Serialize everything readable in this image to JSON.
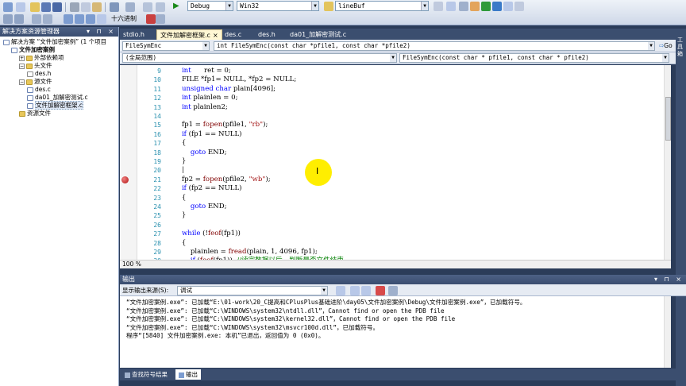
{
  "toolbar": {
    "config": "Debug",
    "platform": "Win32",
    "find_combo": "lineBuf",
    "hex_label": "十六进制",
    "start_symbol": "▶"
  },
  "solution_explorer": {
    "title": "解决方案资源管理器",
    "controls": "▾ ⊓ ×",
    "items": [
      {
        "label": "解决方案 “文件加密案例” (1 个项目",
        "indent": 0,
        "icon": "solution-icon"
      },
      {
        "label": "文件加密案例",
        "indent": 1,
        "icon": "project-icon",
        "bold": true
      },
      {
        "label": "外部依赖项",
        "indent": 2,
        "icon": "folder-icon",
        "expander": "+"
      },
      {
        "label": "头文件",
        "indent": 2,
        "icon": "folder-icon",
        "expander": "−"
      },
      {
        "label": "des.h",
        "indent": 3,
        "icon": "h-file-icon"
      },
      {
        "label": "源文件",
        "indent": 2,
        "icon": "folder-icon",
        "expander": "−"
      },
      {
        "label": "des.c",
        "indent": 3,
        "icon": "c-file-icon"
      },
      {
        "label": "da01_加解密测试.c",
        "indent": 3,
        "icon": "c-file-icon"
      },
      {
        "label": "文件加解密框架.c",
        "indent": 3,
        "icon": "c-file-icon",
        "selected": true
      },
      {
        "label": "资源文件",
        "indent": 2,
        "icon": "folder-icon"
      }
    ]
  },
  "editor": {
    "tabs": [
      {
        "label": "stdio.h",
        "active": false
      },
      {
        "label": "文件加解密框架.c",
        "active": true,
        "close": "×"
      },
      {
        "label": "des.c",
        "active": false
      },
      {
        "label": "des.h",
        "active": false
      },
      {
        "label": "da01_加解密测试.c",
        "active": false
      }
    ],
    "nav_left": "FileSymEnc",
    "nav_right": "int FileSymEnc(const char *pfile1, const char *pfile2)",
    "nav_go": "Go",
    "scope_left": "(全局范围)",
    "scope_right": "FileSymEnc(const char * pfile1, const char * pfile2)",
    "zoom": "100 %",
    "lines": [
      {
        "no": "9",
        "text": "    int      ret = 0;"
      },
      {
        "no": "10",
        "text": "    FILE *fp1= NULL, *fp2 = NULL;"
      },
      {
        "no": "11",
        "text": "    unsigned char plain[4096];"
      },
      {
        "no": "12",
        "text": "    int plainlen = 0;"
      },
      {
        "no": "13",
        "text": "    int plainlen2;"
      },
      {
        "no": "14",
        "text": ""
      },
      {
        "no": "15",
        "text": "    fp1 = fopen(pfile1, \"rb\");"
      },
      {
        "no": "16",
        "text": "    if (fp1 == NULL)"
      },
      {
        "no": "17",
        "text": "    {"
      },
      {
        "no": "18",
        "text": "        goto END;"
      },
      {
        "no": "19",
        "text": "    }"
      },
      {
        "no": "20",
        "text": "    |"
      },
      {
        "no": "21",
        "text": "    fp2 = fopen(pfile2, \"wb\");",
        "breakpoint": true
      },
      {
        "no": "22",
        "text": "    if (fp2 == NULL)"
      },
      {
        "no": "23",
        "text": "    {"
      },
      {
        "no": "24",
        "text": "        goto END;"
      },
      {
        "no": "25",
        "text": "    }"
      },
      {
        "no": "26",
        "text": ""
      },
      {
        "no": "27",
        "text": "    while (!feof(fp1))"
      },
      {
        "no": "28",
        "text": "    {"
      },
      {
        "no": "29",
        "text": "        plainlen = fread(plain, 1, 4096, fp1);"
      },
      {
        "no": "30",
        "text": "        if (feof(fp1))  //读完数据以后，判断是否文件结束"
      }
    ]
  },
  "output": {
    "title": "输出",
    "source_label": "显示输出来源(S):",
    "source_value": "调试",
    "lines": [
      "“文件加密案例.exe”: 已加载“E:\\01-work\\20_C提高和CPlusPlus基础进阶\\day05\\文件加密案例\\Debug\\文件加密案例.exe”，已加载符号。",
      "“文件加密案例.exe”: 已加载“C:\\WINDOWS\\system32\\ntdll.dll”，Cannot find or open the PDB file",
      "“文件加密案例.exe”: 已加载“C:\\WINDOWS\\system32\\kernel32.dll”，Cannot find or open the PDB file",
      "“文件加密案例.exe”: 已加载“C:\\WINDOWS\\system32\\msvcr100d.dll”，已加载符号。",
      "程序“[5840] 文件加密案例.exe: 本机”已退出，返回值为 0 (0x0)。"
    ],
    "tabs": [
      {
        "label": "查找符号结果",
        "active": false
      },
      {
        "label": "输出",
        "active": true
      }
    ]
  },
  "right_strip": {
    "label": "工具箱"
  },
  "colors": {
    "keyword": "#0000ff",
    "string": "#a31515",
    "comment": "#008000",
    "line_number": "#2b91af",
    "cursor_highlight": "#ffee00"
  }
}
